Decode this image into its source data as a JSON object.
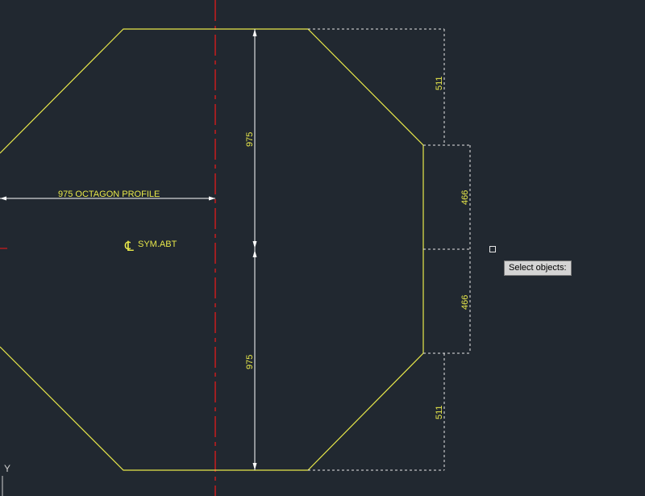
{
  "colors": {
    "background": "#212830",
    "outline": "#e8e84a",
    "dimension_line": "#ffffff",
    "center_line": "#d41c1c",
    "dimension_text": "#e8e84a"
  },
  "labels": {
    "profile": "975 OCTAGON PROFILE",
    "symbol": "SYM.ABT",
    "centerline_symbol": "℄"
  },
  "dimensions": {
    "upper_height": "975",
    "lower_height": "975",
    "right_upper_chamfer": "511",
    "right_middle_upper": "466",
    "right_middle_lower": "466",
    "right_lower_chamfer": "511"
  },
  "command": {
    "prompt": "Select objects:"
  },
  "ucs": {
    "y_axis_label": "Y"
  }
}
